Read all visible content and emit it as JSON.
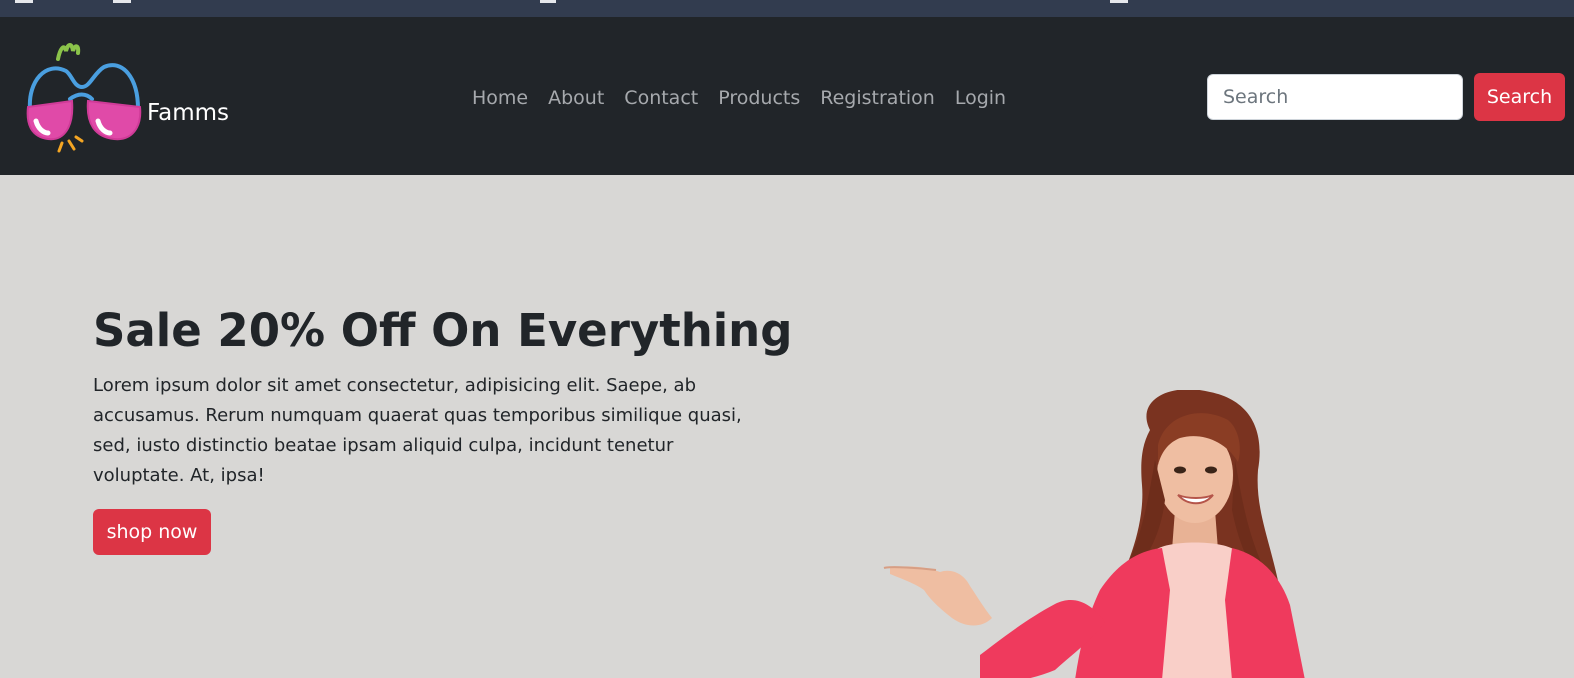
{
  "brand": {
    "name": "Famms",
    "logo_icon": "pink-sunglasses-logo"
  },
  "nav": {
    "items": [
      {
        "label": "Home"
      },
      {
        "label": "About"
      },
      {
        "label": "Contact"
      },
      {
        "label": "Products"
      },
      {
        "label": "Registration"
      },
      {
        "label": "Login"
      }
    ]
  },
  "search": {
    "placeholder": "Search",
    "value": "",
    "button_label": "Search"
  },
  "hero": {
    "title": "Sale 20% Off On Everything",
    "text": "Lorem ipsum dolor sit amet consectetur, adipisicing elit. Saepe, ab accusamus. Rerum numquam quaerat quas temporibus similique quasi, sed, iusto distinctio beatae ipsam aliquid culpa, incidunt tenetur voluptate. At, ipsa!",
    "button_label": "shop now",
    "image": "smiling-woman-pointing-image"
  },
  "colors": {
    "navbar_bg": "#212529",
    "hero_bg": "#d8d7d5",
    "accent": "#dc3545",
    "nav_link": "#a6a9ad"
  }
}
